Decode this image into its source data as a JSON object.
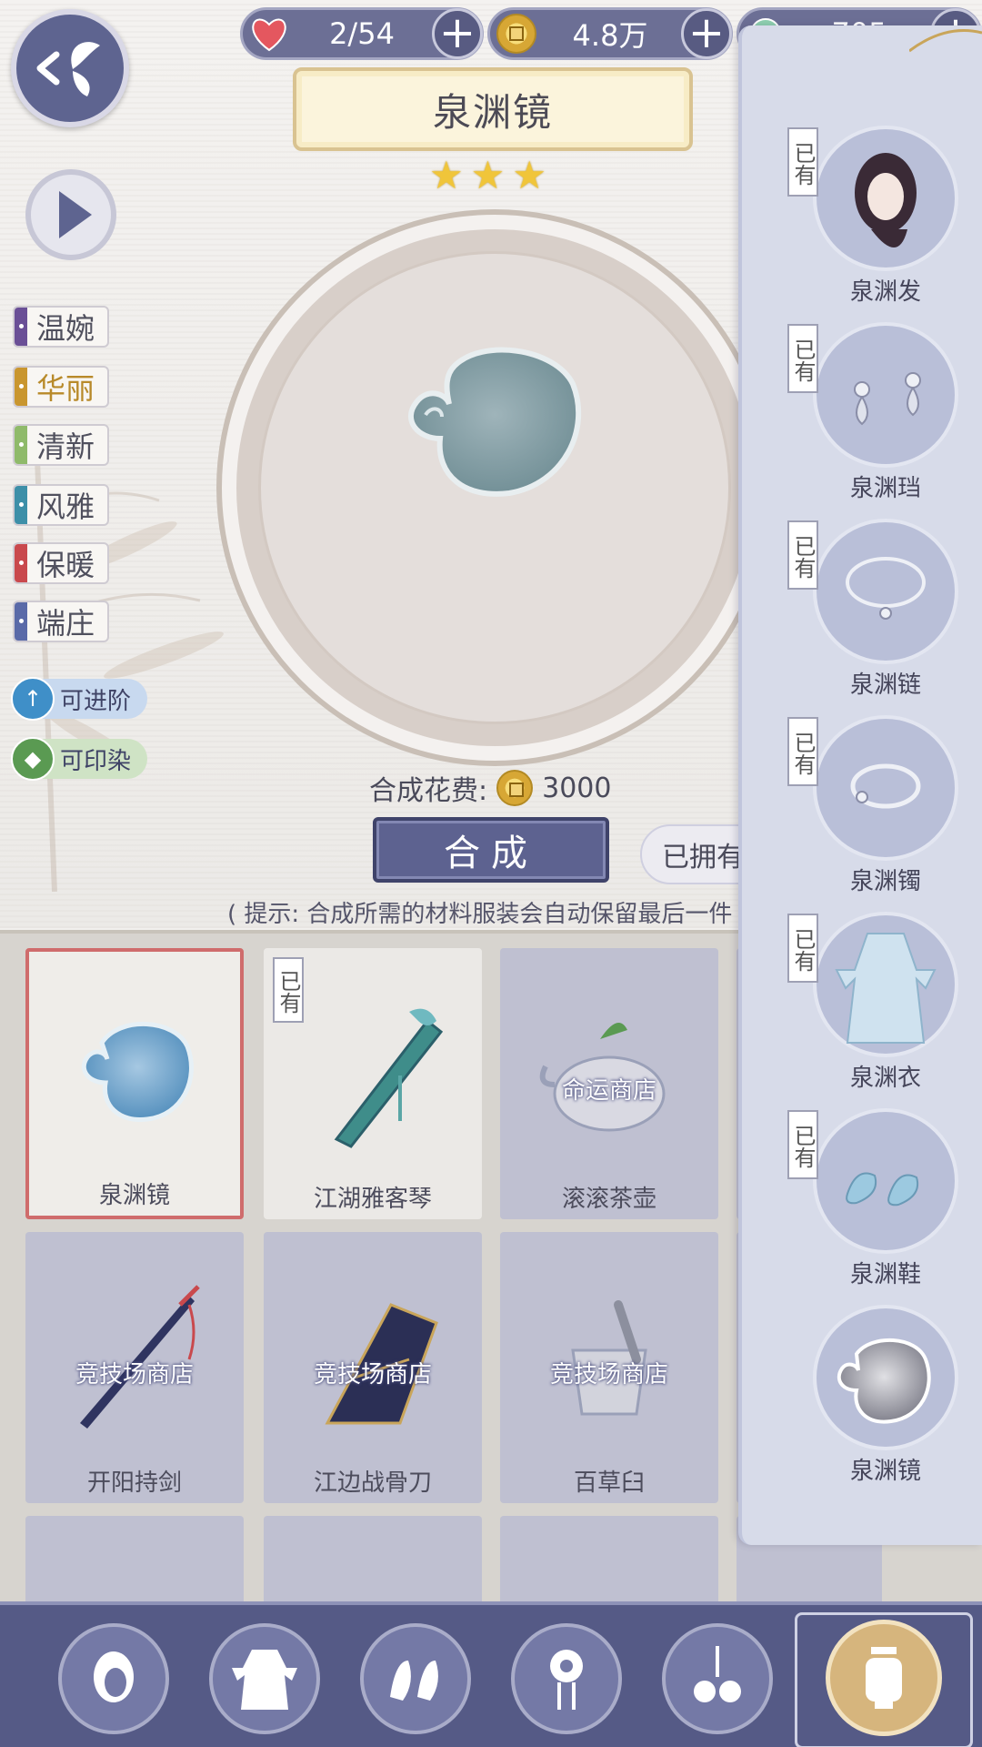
{
  "header": {
    "hearts": "2/54",
    "coins": "4.8万",
    "third_resource": "705",
    "plus_label": "+"
  },
  "title": "泉渊镜",
  "stars": [
    "★",
    "★",
    "★"
  ],
  "tags": [
    {
      "label": "温婉",
      "color": "#6a4f96"
    },
    {
      "label": "华丽",
      "color": "#c9962f"
    },
    {
      "label": "清新",
      "color": "#8fba6a"
    },
    {
      "label": "风雅",
      "color": "#3d8fa8"
    },
    {
      "label": "保暖",
      "color": "#c9494d"
    },
    {
      "label": "端庄",
      "color": "#5a6aa8"
    }
  ],
  "actions": {
    "advance": "可进阶",
    "dye": "可印染"
  },
  "synthesis": {
    "cost_label": "合成花费:",
    "cost_value": "3000",
    "button": "合成",
    "owned_button": "已拥有",
    "hint": "( 提示: 合成所需的材料服装会自动保留最后一件 )"
  },
  "grid": [
    {
      "name": "泉渊镜",
      "owned": false,
      "selected": true,
      "shop": ""
    },
    {
      "name": "江湖雅客琴",
      "owned": true,
      "selected": false,
      "shop": ""
    },
    {
      "name": "滚滚茶壶",
      "owned": false,
      "selected": false,
      "shop": "命运商店"
    },
    {
      "name": "开阳持剑",
      "owned": false,
      "selected": false,
      "shop": "竞技场商店"
    },
    {
      "name": "江边战骨刀",
      "owned": false,
      "selected": false,
      "shop": "竞技场商店"
    },
    {
      "name": "百草臼",
      "owned": false,
      "selected": false,
      "shop": "竞技场商店"
    }
  ],
  "own_tag": "已有",
  "panel": [
    {
      "name": "泉渊发",
      "owned": true,
      "icon": "hair-icon"
    },
    {
      "name": "泉渊珰",
      "owned": true,
      "icon": "earrings-icon"
    },
    {
      "name": "泉渊链",
      "owned": true,
      "icon": "necklace-icon"
    },
    {
      "name": "泉渊镯",
      "owned": true,
      "icon": "bracelet-icon"
    },
    {
      "name": "泉渊衣",
      "owned": true,
      "icon": "dress-icon"
    },
    {
      "name": "泉渊鞋",
      "owned": true,
      "icon": "shoes-icon"
    },
    {
      "name": "泉渊镜",
      "owned": false,
      "icon": "mirror-icon"
    }
  ],
  "bottom_nav": [
    {
      "icon": "hair-nav-icon"
    },
    {
      "icon": "clothing-nav-icon"
    },
    {
      "icon": "shoes-nav-icon"
    },
    {
      "icon": "hairpin-nav-icon"
    },
    {
      "icon": "accessory-nav-icon"
    },
    {
      "icon": "lantern-nav-icon",
      "active": true
    }
  ]
}
